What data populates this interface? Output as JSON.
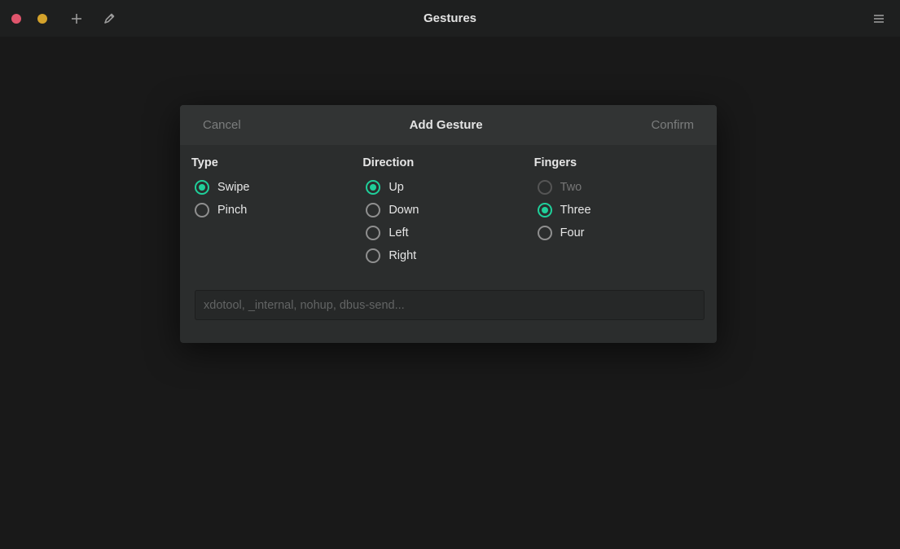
{
  "titlebar": {
    "title": "Gestures"
  },
  "modal": {
    "cancel_label": "Cancel",
    "title": "Add Gesture",
    "confirm_label": "Confirm"
  },
  "columns": {
    "type": {
      "header": "Type",
      "options": [
        {
          "label": "Swipe",
          "selected": true,
          "disabled": false
        },
        {
          "label": "Pinch",
          "selected": false,
          "disabled": false
        }
      ]
    },
    "direction": {
      "header": "Direction",
      "options": [
        {
          "label": "Up",
          "selected": true,
          "disabled": false
        },
        {
          "label": "Down",
          "selected": false,
          "disabled": false
        },
        {
          "label": "Left",
          "selected": false,
          "disabled": false
        },
        {
          "label": "Right",
          "selected": false,
          "disabled": false
        }
      ]
    },
    "fingers": {
      "header": "Fingers",
      "options": [
        {
          "label": "Two",
          "selected": false,
          "disabled": true
        },
        {
          "label": "Three",
          "selected": true,
          "disabled": false
        },
        {
          "label": "Four",
          "selected": false,
          "disabled": false
        }
      ]
    }
  },
  "command": {
    "placeholder": "xdotool, _internal, nohup, dbus-send...",
    "value": ""
  }
}
